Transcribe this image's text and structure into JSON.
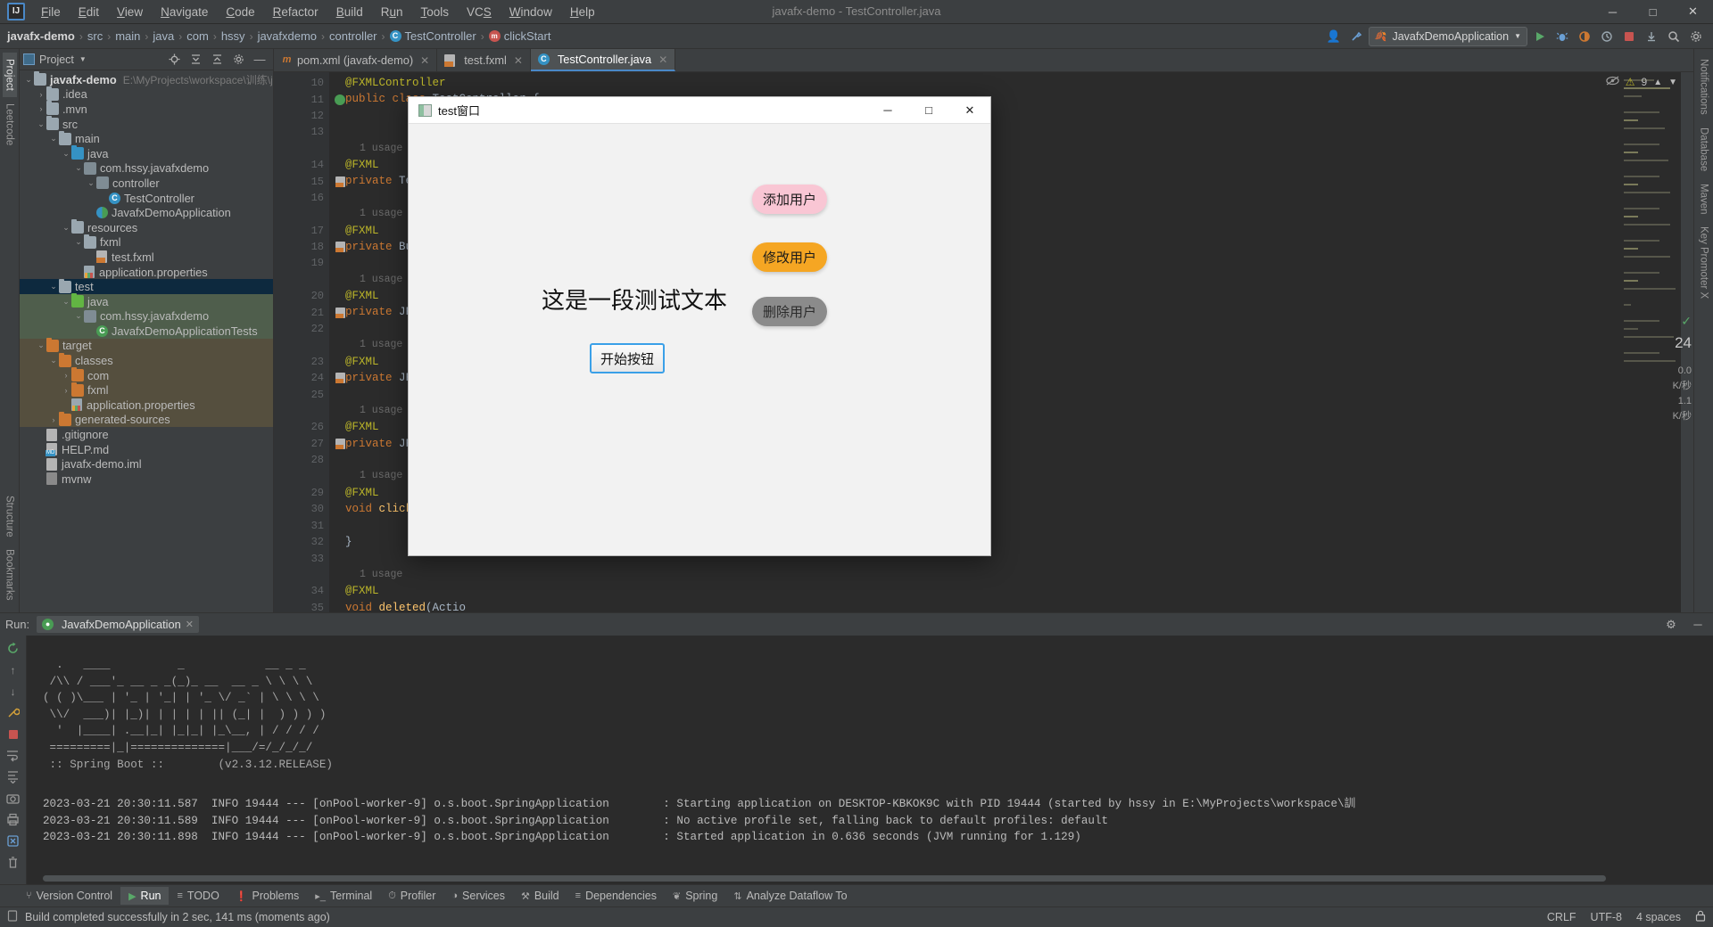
{
  "window": {
    "title": "javafx-demo - TestController.java",
    "minimize": "─",
    "maximize": "□",
    "close": "✕"
  },
  "menu": {
    "items": [
      "File",
      "Edit",
      "View",
      "Navigate",
      "Code",
      "Refactor",
      "Build",
      "Run",
      "Tools",
      "VCS",
      "Window",
      "Help"
    ]
  },
  "breadcrumb": {
    "items": [
      "javafx-demo",
      "src",
      "main",
      "java",
      "com",
      "hssy",
      "javafxdemo",
      "controller",
      "TestController",
      "clickStart"
    ],
    "class_glyph": "C",
    "method_glyph": "m"
  },
  "toolbar": {
    "run_config": "JavafxDemoApplication",
    "dropdown_glyph": "▼",
    "search_glyph": "⌕",
    "settings_glyph": "⚙",
    "hammer_glyph": "⚒",
    "stop_glyph": "■",
    "profile_glyph": "⏱",
    "coverage_glyph": "◐",
    "debug_glyph": "🐞",
    "account_glyph": "👤",
    "updates_glyph": "⬇"
  },
  "left_strip": {
    "tabs": [
      "Project",
      "Leetcode"
    ]
  },
  "right_strip": {
    "tabs": [
      "Notifications",
      "Database",
      "Maven",
      "Key Promoter X"
    ]
  },
  "bottom_strip": {
    "tabs": [
      "Structure",
      "Bookmarks"
    ]
  },
  "project_panel": {
    "title": "Project",
    "icons": [
      "locate-icon",
      "expand-all-icon",
      "collapse-all-icon",
      "settings-icon",
      "hide-icon"
    ],
    "tree": [
      {
        "depth": 0,
        "arrow": "⌄",
        "icon": "folder-module",
        "label": "javafx-demo",
        "bold": true,
        "path": "E:\\MyProjects\\workspace\\训练\\javafx-d",
        "sel": ""
      },
      {
        "depth": 1,
        "arrow": "›",
        "icon": "folder",
        "label": ".idea",
        "bold": false,
        "path": "",
        "sel": ""
      },
      {
        "depth": 1,
        "arrow": "›",
        "icon": "folder",
        "label": ".mvn",
        "bold": false,
        "path": "",
        "sel": ""
      },
      {
        "depth": 1,
        "arrow": "⌄",
        "icon": "folder",
        "label": "src",
        "bold": false,
        "path": "",
        "sel": ""
      },
      {
        "depth": 2,
        "arrow": "⌄",
        "icon": "folder",
        "label": "main",
        "bold": false,
        "path": "",
        "sel": ""
      },
      {
        "depth": 3,
        "arrow": "⌄",
        "icon": "folder-blue",
        "label": "java",
        "bold": false,
        "path": "",
        "sel": ""
      },
      {
        "depth": 4,
        "arrow": "⌄",
        "icon": "package",
        "label": "com.hssy.javafxdemo",
        "bold": false,
        "path": "",
        "sel": ""
      },
      {
        "depth": 5,
        "arrow": "⌄",
        "icon": "package",
        "label": "controller",
        "bold": false,
        "path": "",
        "sel": ""
      },
      {
        "depth": 6,
        "arrow": "",
        "icon": "class",
        "label": "TestController",
        "bold": false,
        "path": "",
        "sel": ""
      },
      {
        "depth": 5,
        "arrow": "",
        "icon": "springclass",
        "label": "JavafxDemoApplication",
        "bold": false,
        "path": "",
        "sel": ""
      },
      {
        "depth": 3,
        "arrow": "⌄",
        "icon": "folder-res",
        "label": "resources",
        "bold": false,
        "path": "",
        "sel": ""
      },
      {
        "depth": 4,
        "arrow": "⌄",
        "icon": "folder",
        "label": "fxml",
        "bold": false,
        "path": "",
        "sel": ""
      },
      {
        "depth": 5,
        "arrow": "",
        "icon": "xmlfile",
        "label": "test.fxml",
        "bold": false,
        "path": "",
        "sel": ""
      },
      {
        "depth": 4,
        "arrow": "",
        "icon": "propfile",
        "label": "application.properties",
        "bold": false,
        "path": "",
        "sel": ""
      },
      {
        "depth": 2,
        "arrow": "⌄",
        "icon": "folder",
        "label": "test",
        "bold": false,
        "path": "",
        "sel": "sel-dark"
      },
      {
        "depth": 3,
        "arrow": "⌄",
        "icon": "folder-green",
        "label": "java",
        "bold": false,
        "path": "",
        "sel": "sel-green"
      },
      {
        "depth": 4,
        "arrow": "⌄",
        "icon": "package",
        "label": "com.hssy.javafxdemo",
        "bold": false,
        "path": "",
        "sel": "sel-green"
      },
      {
        "depth": 5,
        "arrow": "",
        "icon": "testclass",
        "label": "JavafxDemoApplicationTests",
        "bold": false,
        "path": "",
        "sel": "sel-green"
      },
      {
        "depth": 1,
        "arrow": "⌄",
        "icon": "folder-orange",
        "label": "target",
        "bold": false,
        "path": "",
        "sel": "sel-brown"
      },
      {
        "depth": 2,
        "arrow": "⌄",
        "icon": "folder-orange",
        "label": "classes",
        "bold": false,
        "path": "",
        "sel": "sel-brown"
      },
      {
        "depth": 3,
        "arrow": "›",
        "icon": "folder-orange",
        "label": "com",
        "bold": false,
        "path": "",
        "sel": "sel-brown"
      },
      {
        "depth": 3,
        "arrow": "›",
        "icon": "folder-orange",
        "label": "fxml",
        "bold": false,
        "path": "",
        "sel": "sel-brown"
      },
      {
        "depth": 3,
        "arrow": "",
        "icon": "propfile",
        "label": "application.properties",
        "bold": false,
        "path": "",
        "sel": "sel-brown"
      },
      {
        "depth": 2,
        "arrow": "›",
        "icon": "folder-orange",
        "label": "generated-sources",
        "bold": false,
        "path": "",
        "sel": "sel-brown"
      },
      {
        "depth": 1,
        "arrow": "",
        "icon": "gitignore",
        "label": ".gitignore",
        "bold": false,
        "path": "",
        "sel": ""
      },
      {
        "depth": 1,
        "arrow": "",
        "icon": "mdfile",
        "label": "HELP.md",
        "bold": false,
        "path": "",
        "sel": ""
      },
      {
        "depth": 1,
        "arrow": "",
        "icon": "imlfile",
        "label": "javafx-demo.iml",
        "bold": false,
        "path": "",
        "sel": ""
      },
      {
        "depth": 1,
        "arrow": "",
        "icon": "shfile",
        "label": "mvnw",
        "bold": false,
        "path": "",
        "sel": ""
      }
    ]
  },
  "editor": {
    "tabs": [
      {
        "label": "pom.xml (javafx-demo)",
        "icon": "maven-icon",
        "active": false,
        "close": "✕"
      },
      {
        "label": "test.fxml",
        "icon": "xml-icon",
        "active": false,
        "close": "✕"
      },
      {
        "label": "TestController.java",
        "icon": "class-icon",
        "active": true,
        "close": "✕"
      }
    ],
    "inspection": {
      "eye_glyph": "👁",
      "warning_glyph": "⚠",
      "warning_count": "9",
      "check_glyph": "✓",
      "chevron": "⌄"
    },
    "lines": [
      {
        "num": "10",
        "gutter": "",
        "usage": "",
        "code": "@FXMLController",
        "kind": "ann"
      },
      {
        "num": "11",
        "gutter": "spring",
        "usage": "",
        "code": "public class TestController {",
        "kind": "decl"
      },
      {
        "num": "12",
        "gutter": "",
        "usage": "",
        "code": "",
        "kind": "blank"
      },
      {
        "num": "13",
        "gutter": "",
        "usage": "",
        "code": "",
        "kind": "blank"
      },
      {
        "num": "",
        "gutter": "",
        "usage": "1 usage",
        "code": "",
        "kind": "usage"
      },
      {
        "num": "14",
        "gutter": "",
        "usage": "",
        "code": "@FXML",
        "kind": "ann"
      },
      {
        "num": "15",
        "gutter": "fxml",
        "usage": "",
        "code": "private Text testT",
        "kind": "field"
      },
      {
        "num": "16",
        "gutter": "",
        "usage": "",
        "code": "",
        "kind": "blank"
      },
      {
        "num": "",
        "gutter": "",
        "usage": "1 usage",
        "code": "",
        "kind": "usage"
      },
      {
        "num": "17",
        "gutter": "",
        "usage": "",
        "code": "@FXML",
        "kind": "ann"
      },
      {
        "num": "18",
        "gutter": "fxml",
        "usage": "",
        "code": "private Button tes",
        "kind": "field"
      },
      {
        "num": "19",
        "gutter": "",
        "usage": "",
        "code": "",
        "kind": "blank"
      },
      {
        "num": "",
        "gutter": "",
        "usage": "1 usage",
        "code": "",
        "kind": "usage"
      },
      {
        "num": "20",
        "gutter": "",
        "usage": "",
        "code": "@FXML",
        "kind": "ann"
      },
      {
        "num": "21",
        "gutter": "fxml",
        "usage": "",
        "code": "private JFXButton",
        "kind": "field"
      },
      {
        "num": "22",
        "gutter": "",
        "usage": "",
        "code": "",
        "kind": "blank"
      },
      {
        "num": "",
        "gutter": "",
        "usage": "1 usage",
        "code": "",
        "kind": "usage"
      },
      {
        "num": "23",
        "gutter": "",
        "usage": "",
        "code": "@FXML",
        "kind": "ann"
      },
      {
        "num": "24",
        "gutter": "fxml",
        "usage": "",
        "code": "private JFXButton",
        "kind": "field"
      },
      {
        "num": "25",
        "gutter": "",
        "usage": "",
        "code": "",
        "kind": "blank"
      },
      {
        "num": "",
        "gutter": "",
        "usage": "1 usage",
        "code": "",
        "kind": "usage"
      },
      {
        "num": "26",
        "gutter": "",
        "usage": "",
        "code": "@FXML",
        "kind": "ann"
      },
      {
        "num": "27",
        "gutter": "fxml",
        "usage": "",
        "code": "private JFXButton",
        "kind": "field"
      },
      {
        "num": "28",
        "gutter": "",
        "usage": "",
        "code": "",
        "kind": "blank"
      },
      {
        "num": "",
        "gutter": "",
        "usage": "1 usage",
        "code": "",
        "kind": "usage"
      },
      {
        "num": "29",
        "gutter": "",
        "usage": "",
        "code": "@FXML",
        "kind": "ann"
      },
      {
        "num": "30",
        "gutter": "",
        "usage": "",
        "code": "void clickStart(Ac",
        "kind": "method"
      },
      {
        "num": "31",
        "gutter": "",
        "usage": "",
        "code": "",
        "kind": "blank"
      },
      {
        "num": "32",
        "gutter": "",
        "usage": "",
        "code": "}",
        "kind": "pun"
      },
      {
        "num": "33",
        "gutter": "",
        "usage": "",
        "code": "",
        "kind": "blank"
      },
      {
        "num": "",
        "gutter": "",
        "usage": "1 usage",
        "code": "",
        "kind": "usage"
      },
      {
        "num": "34",
        "gutter": "",
        "usage": "",
        "code": "@FXML",
        "kind": "ann"
      },
      {
        "num": "35",
        "gutter": "",
        "usage": "",
        "code": "void deleted(Actio",
        "kind": "method"
      }
    ]
  },
  "fx_window": {
    "title": "test窗口",
    "minimize": "─",
    "maximize": "□",
    "close": "✕",
    "text_label": "这是一段测试文本",
    "buttons": {
      "add": "添加用户",
      "modify": "修改用户",
      "delete": "删除用户",
      "start": "开始按钮"
    },
    "colors": {
      "add_bg": "#f9c6d4",
      "modify_bg": "#f5a623",
      "delete_bg": "#8b8b8b",
      "start_border": "#3aa0e8"
    }
  },
  "run_window": {
    "label": "Run:",
    "tab": "JavafxDemoApplication",
    "tab_close": "✕",
    "settings_glyph": "⚙",
    "hide_glyph": "─",
    "tools": [
      "rerun-icon",
      "up-icon",
      "down-icon",
      "wrench-icon",
      "stop-icon",
      "soft-wrap-icon",
      "camera-icon",
      "print-icon",
      "scroll-end-icon",
      "clear-icon",
      "trash-icon"
    ],
    "banner": [
      "  .   ____          _            __ _ _",
      " /\\\\ / ___'_ __ _ _(_)_ __  __ _ \\ \\ \\ \\",
      "( ( )\\___ | '_ | '_| | '_ \\/ _` | \\ \\ \\ \\",
      " \\\\/  ___)| |_)| | | | | || (_| |  ) ) ) )",
      "  '  |____| .__|_| |_|_| |_\\__, | / / / /",
      " =========|_|==============|___/=/_/_/_/",
      " :: Spring Boot ::        (v2.3.12.RELEASE)"
    ],
    "logs": [
      {
        "ts": "2023-03-21 20:30:11.587",
        "level": "INFO",
        "pid": "19444",
        "sep": "---",
        "thread": "[onPool-worker-9]",
        "logger": "o.s.boot.SpringApplication",
        "msg": ": Starting application on DESKTOP-KBKOK9C with PID 19444 (started by hssy in E:\\MyProjects\\workspace\\訓"
      },
      {
        "ts": "2023-03-21 20:30:11.589",
        "level": "INFO",
        "pid": "19444",
        "sep": "---",
        "thread": "[onPool-worker-9]",
        "logger": "o.s.boot.SpringApplication",
        "msg": ": No active profile set, falling back to default profiles: default"
      },
      {
        "ts": "2023-03-21 20:30:11.898",
        "level": "INFO",
        "pid": "19444",
        "sep": "---",
        "thread": "[onPool-worker-9]",
        "logger": "o.s.boot.SpringApplication",
        "msg": ": Started application in 0.636 seconds (JVM running for 1.129)"
      }
    ]
  },
  "bottom_tool_tabs": [
    {
      "label": "Version Control",
      "icon": "branch-icon",
      "active": false
    },
    {
      "label": "Run",
      "icon": "play-icon",
      "active": true
    },
    {
      "label": "TODO",
      "icon": "list-icon",
      "active": false
    },
    {
      "label": "Problems",
      "icon": "error-icon",
      "active": false
    },
    {
      "label": "Terminal",
      "icon": "terminal-icon",
      "active": false
    },
    {
      "label": "Profiler",
      "icon": "profiler-icon",
      "active": false
    },
    {
      "label": "Services",
      "icon": "services-icon",
      "active": false
    },
    {
      "label": "Build",
      "icon": "hammer-icon",
      "active": false
    },
    {
      "label": "Dependencies",
      "icon": "dependencies-icon",
      "active": false
    },
    {
      "label": "Spring",
      "icon": "leaf-icon",
      "active": false
    },
    {
      "label": "Analyze Dataflow To",
      "icon": "dataflow-icon",
      "active": false
    }
  ],
  "status_bar": {
    "message": "Build completed successfully in 2 sec, 141 ms (moments ago)",
    "line_sep": "CRLF",
    "encoding": "UTF-8",
    "indent": "4 spaces",
    "lock_glyph": "🔒"
  },
  "right_widgets": {
    "num1": "24",
    "num2": "0.0",
    "unit2": "K/秒",
    "num3": "1.1",
    "unit3": "K/秒",
    "check": "✓"
  }
}
